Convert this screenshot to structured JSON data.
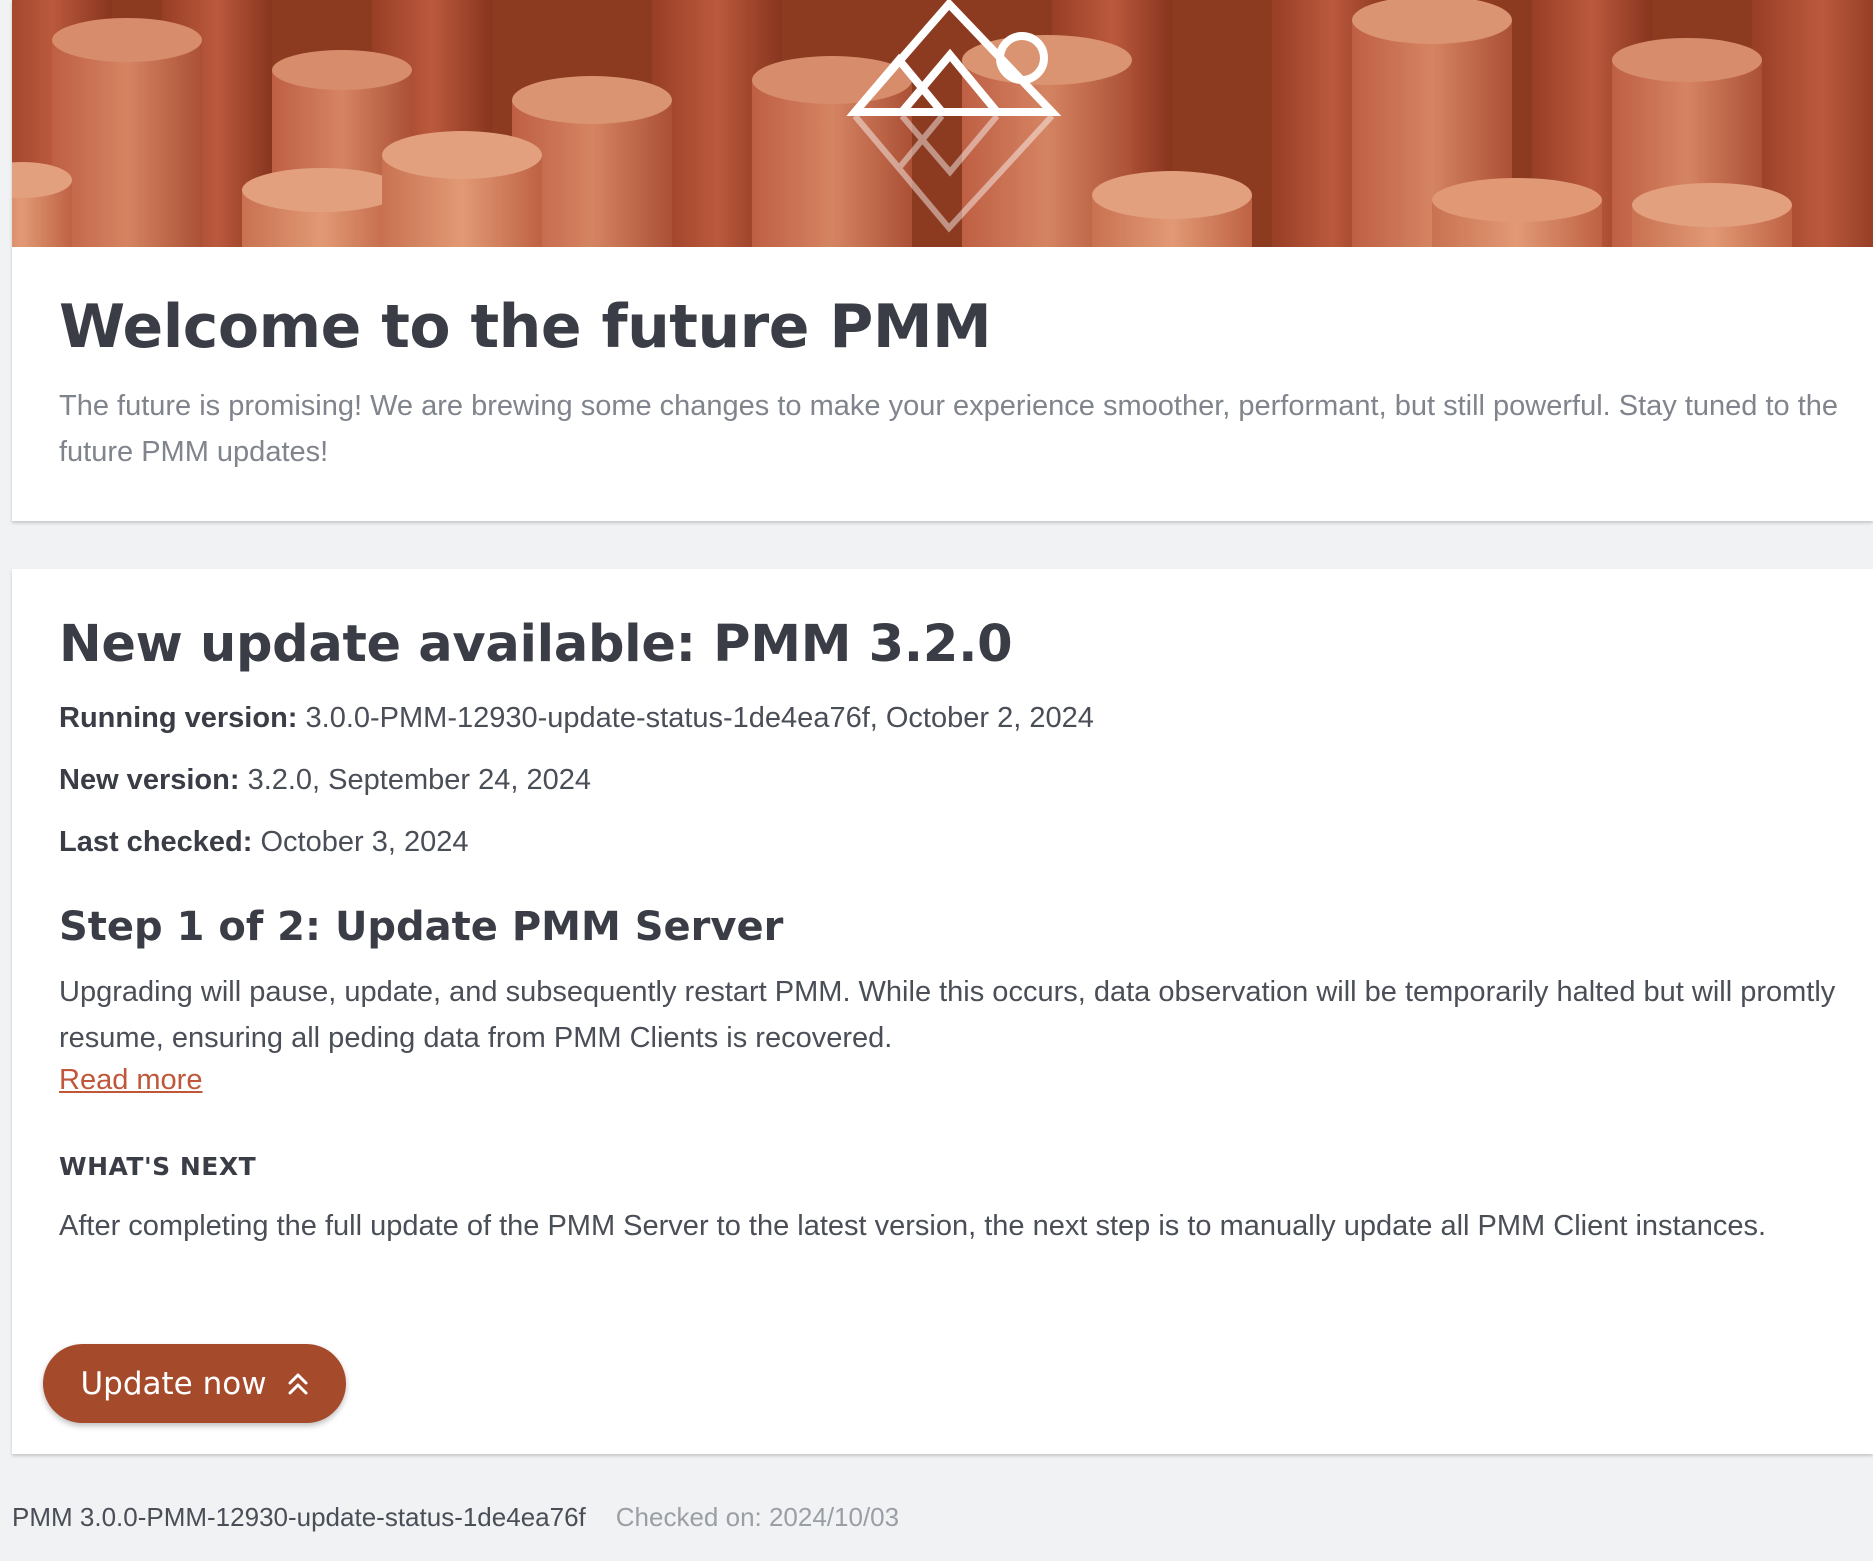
{
  "welcome": {
    "title": "Welcome to the future PMM",
    "description": "The future is promising! We are brewing some changes to make your experience smoother, performant, but still powerful. Stay tuned to the future PMM updates!",
    "hero_icon": "percona-mountain-logo"
  },
  "update": {
    "title": "New update available: PMM 3.2.0",
    "running_label": "Running version:",
    "running_value": "3.0.0-PMM-12930-update-status-1de4ea76f, October 2, 2024",
    "new_label": "New version:",
    "new_value": "3.2.0, September 24, 2024",
    "checked_label": "Last checked:",
    "checked_value": "October 3, 2024",
    "step_title": "Step 1 of 2: Update PMM Server",
    "step_text": "Upgrading will pause, update, and subsequently restart PMM. While this occurs, data observation will be temporarily halted but will promtly resume, ensuring all peding data from PMM Clients is recovered.",
    "read_more": "Read more",
    "whats_next_heading": "WHAT'S NEXT",
    "whats_next_text": "After completing the full update of the PMM Server to the latest version, the next step is to manually update all PMM Client instances.",
    "button_label": "Update now",
    "button_icon": "double-chevron-up-icon"
  },
  "footer": {
    "version": "PMM 3.0.0-PMM-12930-update-status-1de4ea76f",
    "checked_on": "Checked on: 2024/10/03"
  },
  "colors": {
    "accent": "#a54a2a",
    "link": "#c0573a",
    "background": "#f1f2f4",
    "card": "#ffffff",
    "heading": "#3a3d46",
    "muted": "#80848c"
  }
}
